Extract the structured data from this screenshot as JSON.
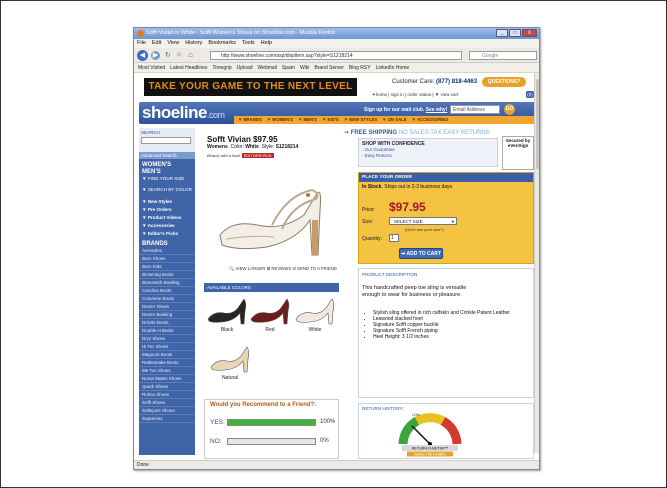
{
  "window": {
    "title": "Sofft Vivian in White - Sofft Women's Shoes on Shoeline.com - Mozilla Firefox",
    "controls": [
      "_",
      "□",
      "X"
    ]
  },
  "menu": [
    "File",
    "Edit",
    "View",
    "History",
    "Bookmarks",
    "Tools",
    "Help"
  ],
  "nav": {
    "url": "http://www.shoeline.com/asp/displtem.asp?style=S1218214",
    "search_placeholder": "Google"
  },
  "bookmarks": [
    "Most Visited",
    "Latest Headlines",
    "Timegrip",
    "Upload",
    "Webmail",
    "Spam",
    "Wiki",
    "Brand Server",
    "Blog RSY",
    "LinkedIn Home"
  ],
  "status": "Done",
  "header": {
    "banner": "TAKE YOUR GAME TO THE NEXT LEVEL",
    "care_label": "Customer Care:",
    "care_phone": "(877) 818-4463",
    "live_btn": "QUESTIONS?",
    "toplinks": "✦home | sign in | order status | ▼ view cart",
    "cart_count": "(0)",
    "logo_main": "shoeline",
    "logo_suffix": ".com",
    "signup": "Sign up for our mail club.",
    "see_why": "See why!",
    "email_placeholder": "Email Address",
    "go": "GO",
    "categories": [
      "▼ BRANDS",
      "▼ WOMEN'S",
      "▼ MEN'S",
      "▼ KID'S",
      "▼ NEW STYLES",
      "▼ ON SALE",
      "▼ ACCESSORIES"
    ]
  },
  "sidebar": {
    "search_label": "SEARCH",
    "adv_search": "Advanced Search",
    "women": "WOMEN'S",
    "men": "MEN'S",
    "find": "▼ FIND YOUR SIZE",
    "search_color": "▼ SEARCH BY COLOR",
    "links": [
      "▼ New Styles",
      "▼ Pre Orders",
      "▼ Product Videos",
      "▼ Accessories",
      "▼ Editor's Picks"
    ],
    "brands_label": "BRANDS",
    "brands": [
      "Aerosoles",
      "Born Shoes",
      "Born Kids",
      "Browning Boots",
      "Brunswick Bowling",
      "Carolina Boots",
      "Converse Boots",
      "Dexter Shoes",
      "Dexter Bowling",
      "Drizzle Boots",
      "Double H Boots",
      "Dryz Shoes",
      "Hi Tec Shoes",
      "Magnum Boots",
      "Rattlesnake Boots",
      "Me Too Shoes",
      "Nurse Mates Shoes",
      "Quark Shoes",
      "Rulmo Shoes",
      "Sofft Shoes",
      "Softspots Shoes",
      "Supremes"
    ]
  },
  "product": {
    "title": "Sofft  Vivian  $97.95",
    "gender": "Womens",
    "color_label": "Color:",
    "color": "White",
    "style_label": "Style:",
    "style": "S1218214",
    "editors": "Beauty with a fault",
    "editors_tag": "EDITORS PICK",
    "actions": "🔍 VIEW LARGER   ⊞ REVIEWS   ✉ SEND TO A FRIEND",
    "available": "AVAILABLE COLORS",
    "colors": [
      {
        "name": "Black",
        "hex": "#2a2422"
      },
      {
        "name": "Red",
        "hex": "#6e1d1f"
      },
      {
        "name": "White",
        "hex": "#efe9df"
      },
      {
        "name": "Natural",
        "hex": "#e7d6b8"
      }
    ]
  },
  "recommend": {
    "question": "Would you Recommend to a Friend?:",
    "yes": "YES:",
    "yes_pct": "100%",
    "yes_value": 100,
    "no": "NO:",
    "no_pct": "0%",
    "no_value": 0
  },
  "shipping": {
    "free": "FREE SHIPPING",
    "notax": "NO SALES TAX",
    "returns": "EASY RETURNS"
  },
  "confidence": {
    "title": "SHOP WITH CONFIDENCE",
    "items": [
      "- Our Guarantee",
      "- Easy Returns"
    ],
    "secure": "Secured by ●VeriSign"
  },
  "order": {
    "head": "PLACE YOUR ORDER",
    "instock": "In Stock.",
    "ships": "Ships out in 2-3 business days.",
    "price_label": "Price:",
    "price": "$97.95",
    "size_label": "Size:",
    "size_value": "SELECT SIZE",
    "size_help": "(Don't see your size?)",
    "qty_label": "Quantity:",
    "qty": "1",
    "addcart": "➡ ADD TO CART"
  },
  "description": {
    "head": "PRODUCT DESCRIPTION",
    "text": "This handcrafted peep toe sling is versatile enough to wear for business or pleasure.",
    "bullets": [
      "Stylish sling offered in rich calfskin and Crinkle Patent Leather",
      "Leawood stacked heel",
      "Signature Sofft copper buckle",
      "Signature Sofft French piping",
      "Heel Height: 3 1/2 inches"
    ]
  },
  "returns": {
    "head": "RETURN HISTORY:",
    "gauge_label": "RETURN-O-METER™",
    "gauge_sub": "RARELY RETURNED",
    "needle": "LOW"
  },
  "colors": {
    "accent": "#3f64a8",
    "order_bg": "#f5c342",
    "price": "#a11a1a",
    "bar_yes": "#3bb33b"
  }
}
